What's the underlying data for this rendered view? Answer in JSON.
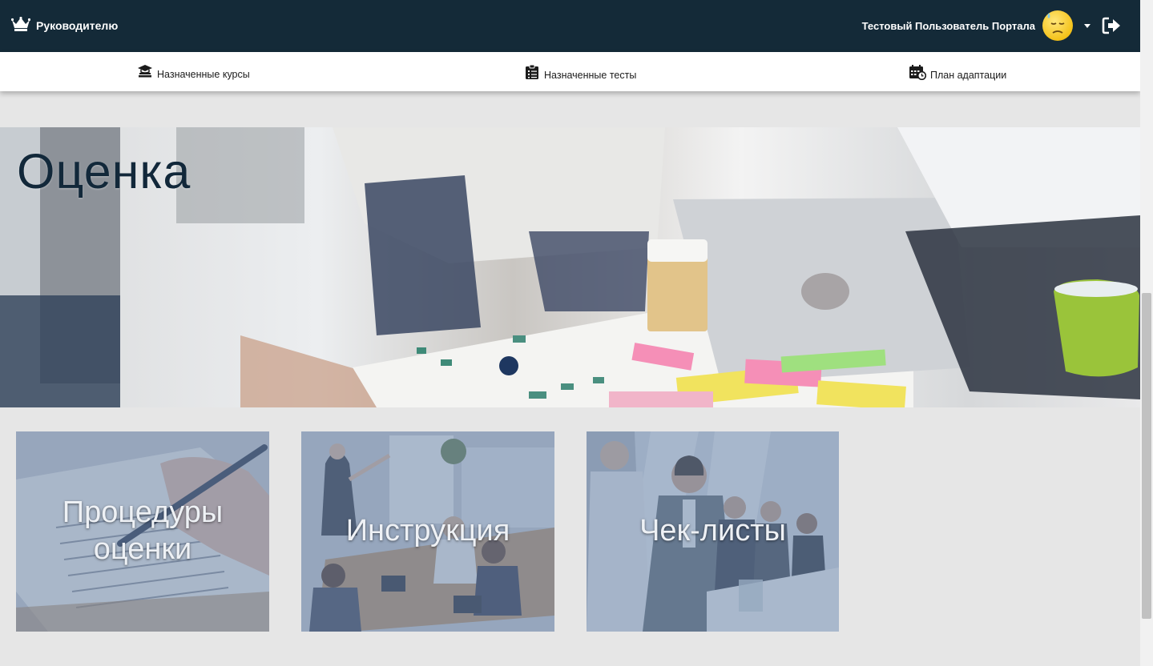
{
  "header": {
    "brand_label": "Руководителю",
    "brand_icon": "crown-icon",
    "user_name": "Тестовый Пользователь Портала",
    "avatar_icon": "sad-face-emoji-icon",
    "logout_icon": "logout-icon",
    "colors": {
      "background": "#142a38",
      "text": "#ffffff"
    }
  },
  "nav": {
    "items": [
      {
        "label": "Назначенные курсы",
        "icon": "graduation-cap-books-icon"
      },
      {
        "label": "Назначенные тесты",
        "icon": "clipboard-checklist-icon"
      },
      {
        "label": "План адаптации",
        "icon": "calendar-clock-icon"
      }
    ]
  },
  "hero": {
    "title": "Оценка",
    "image": "office team reviewing charts at desk with laptop"
  },
  "cards": [
    {
      "label": "Процедуры оценки",
      "image": "hand with pen filling form"
    },
    {
      "label": "Инструкция",
      "image": "presenter at meeting room flipchart"
    },
    {
      "label": "Чек-листы",
      "image": "business people in conference meeting"
    }
  ],
  "colors": {
    "page_background": "#e6e6e6",
    "card_overlay": "#6e86aa",
    "hero_title": "#12283a"
  }
}
